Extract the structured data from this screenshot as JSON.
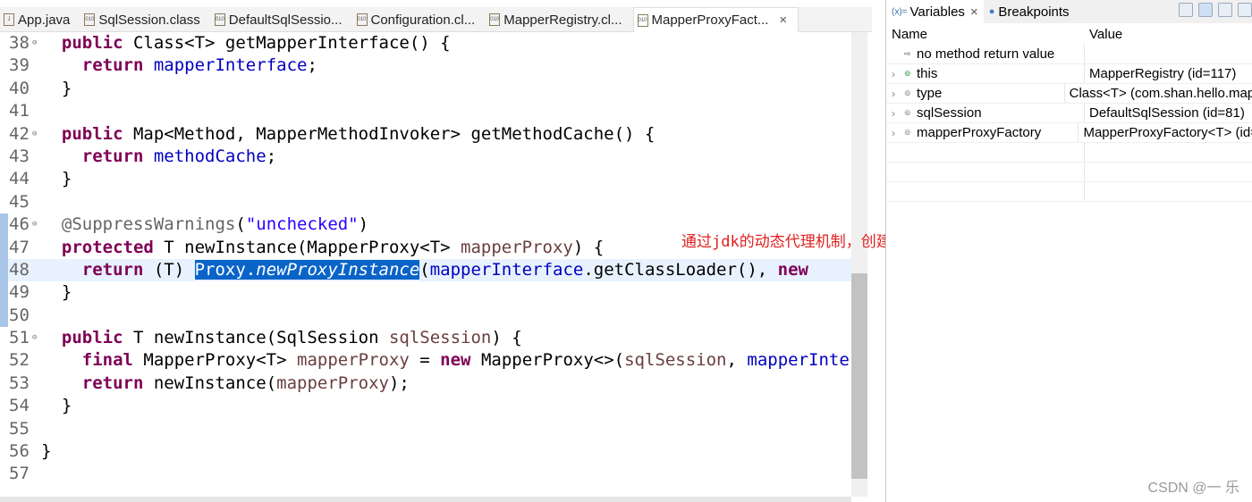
{
  "editor": {
    "tabs": [
      {
        "label": "App.java",
        "icon": "java-file-icon"
      },
      {
        "label": "SqlSession.class",
        "icon": "class-file-icon"
      },
      {
        "label": "DefaultSqlSessio...",
        "icon": "class-file-icon"
      },
      {
        "label": "Configuration.cl...",
        "icon": "class-file-icon"
      },
      {
        "label": "MapperRegistry.cl...",
        "icon": "class-file-icon"
      },
      {
        "label": "MapperProxyFact...",
        "icon": "class-file-icon",
        "active": true,
        "close": "×"
      }
    ],
    "lines": [
      {
        "n": "38",
        "fold": true,
        "t": [
          [
            "  ",
            ""
          ],
          [
            "public",
            "kw"
          ],
          [
            " Class<T> getMapperInterface() {",
            ""
          ]
        ]
      },
      {
        "n": "39",
        "t": [
          [
            "    ",
            ""
          ],
          [
            "return",
            "kw"
          ],
          [
            " ",
            ""
          ],
          [
            "mapperInterface",
            "fld"
          ],
          [
            ";",
            ""
          ]
        ]
      },
      {
        "n": "40",
        "t": [
          [
            "  }",
            ""
          ]
        ]
      },
      {
        "n": "41",
        "t": []
      },
      {
        "n": "42",
        "fold": true,
        "t": [
          [
            "  ",
            ""
          ],
          [
            "public",
            "kw"
          ],
          [
            " Map<Method, MapperMethodInvoker> getMethodCache() {",
            ""
          ]
        ]
      },
      {
        "n": "43",
        "t": [
          [
            "    ",
            ""
          ],
          [
            "return",
            "kw"
          ],
          [
            " ",
            ""
          ],
          [
            "methodCache",
            "fld"
          ],
          [
            ";",
            ""
          ]
        ]
      },
      {
        "n": "44",
        "t": [
          [
            "  }",
            ""
          ]
        ]
      },
      {
        "n": "45",
        "t": []
      },
      {
        "n": "46",
        "fold": true,
        "t": [
          [
            "  ",
            ""
          ],
          [
            "@SuppressWarnings",
            "ann"
          ],
          [
            "(",
            ""
          ],
          [
            "\"unchecked\"",
            "str"
          ],
          [
            ")",
            ""
          ]
        ]
      },
      {
        "n": "47",
        "t": [
          [
            "  ",
            ""
          ],
          [
            "protected",
            "kw"
          ],
          [
            " T newInstance(MapperProxy<T> ",
            ""
          ],
          [
            "mapperProxy",
            "prm"
          ],
          [
            ") {",
            ""
          ]
        ]
      },
      {
        "n": "48",
        "current": true,
        "t": [
          [
            "    ",
            ""
          ],
          [
            "return",
            "kw"
          ],
          [
            " (T) ",
            ""
          ],
          [
            "Proxy.",
            "sel"
          ],
          [
            "newProxyInstance",
            "sel it"
          ],
          [
            "(",
            ""
          ],
          [
            "mapperInterface",
            "fld"
          ],
          [
            ".getClassLoader(), ",
            ""
          ],
          [
            "new",
            "kw"
          ]
        ]
      },
      {
        "n": "49",
        "t": [
          [
            "  }",
            ""
          ]
        ]
      },
      {
        "n": "50",
        "t": []
      },
      {
        "n": "51",
        "fold": true,
        "t": [
          [
            "  ",
            ""
          ],
          [
            "public",
            "kw"
          ],
          [
            " T newInstance(SqlSession ",
            ""
          ],
          [
            "sqlSession",
            "prm"
          ],
          [
            ") {",
            ""
          ]
        ]
      },
      {
        "n": "52",
        "t": [
          [
            "    ",
            ""
          ],
          [
            "final",
            "kw"
          ],
          [
            " MapperProxy<T> ",
            ""
          ],
          [
            "mapperProxy",
            "prm"
          ],
          [
            " = ",
            ""
          ],
          [
            "new",
            "kw"
          ],
          [
            " MapperProxy<>(",
            ""
          ],
          [
            "sqlSession",
            "prm"
          ],
          [
            ", ",
            ""
          ],
          [
            "mapperInterface",
            "fld"
          ]
        ]
      },
      {
        "n": "53",
        "t": [
          [
            "    ",
            ""
          ],
          [
            "return",
            "kw"
          ],
          [
            " newInstance(",
            ""
          ],
          [
            "mapperProxy",
            "prm"
          ],
          [
            ");",
            ""
          ]
        ]
      },
      {
        "n": "54",
        "t": [
          [
            "  }",
            ""
          ]
        ]
      },
      {
        "n": "55",
        "t": []
      },
      {
        "n": "56",
        "t": [
          [
            "}",
            ""
          ]
        ]
      },
      {
        "n": "57",
        "t": []
      }
    ],
    "annotation": "通过jdk的动态代理机制，创建一个mapper的代理对象"
  },
  "variables": {
    "tab_variables": "Variables",
    "tab_close": "×",
    "tab_breakpoints": "Breakpoints",
    "col_name": "Name",
    "col_value": "Value",
    "rows": [
      {
        "name": "no method return value",
        "value": "",
        "icon": "return-value-icon"
      },
      {
        "name": "this",
        "value": "MapperRegistry  (id=117)",
        "icon": "field-dot-icon",
        "dot_color": "#2e9a4a"
      },
      {
        "name": "type",
        "value": "Class<T> (com.shan.hello.mapper",
        "icon": "local-var-icon",
        "dot_color": "#888888"
      },
      {
        "name": "sqlSession",
        "value": "DefaultSqlSession  (id=81)",
        "icon": "local-var-icon",
        "dot_color": "#888888"
      },
      {
        "name": "mapperProxyFactory",
        "value": "MapperProxyFactory<T>  (id=",
        "icon": "local-var-icon",
        "dot_color": "#888888"
      }
    ]
  },
  "watermark": "CSDN @一 乐"
}
